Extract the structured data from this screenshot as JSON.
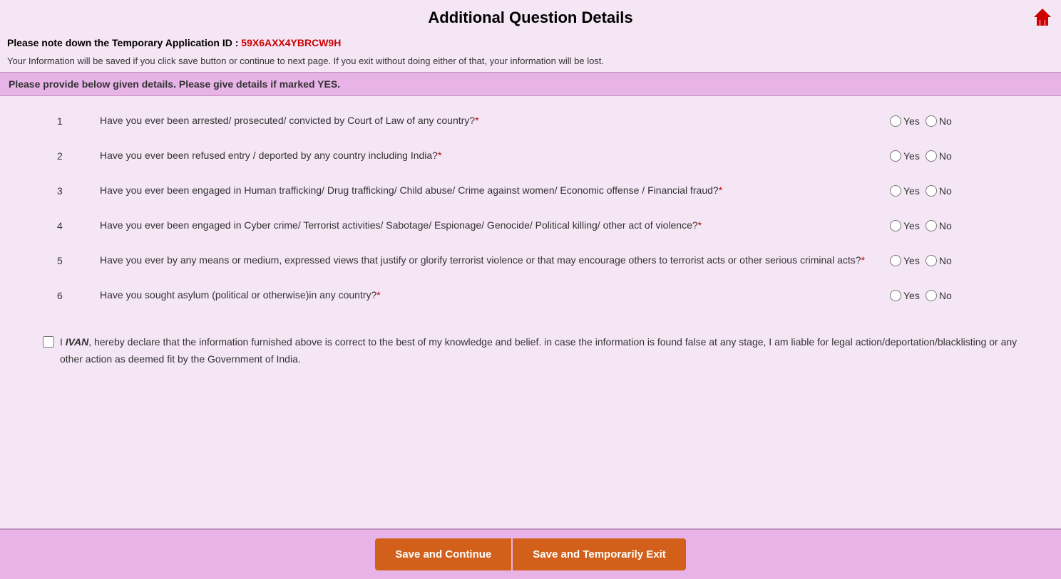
{
  "header": {
    "title": "Additional Question Details",
    "home_icon": "home"
  },
  "temp_id": {
    "label": "Please note down the Temporary Application ID :",
    "value": "59X6AXX4YBRCW9H"
  },
  "info_text": "Your Information will be saved if you click save button or continue to next page. If you exit without doing either of that, your information will be lost.",
  "notice": "Please provide below given details. Please give details if marked YES.",
  "questions": [
    {
      "number": "1",
      "text": "Have you ever been arrested/ prosecuted/ convicted by Court of Law of any country?",
      "required": true
    },
    {
      "number": "2",
      "text": "Have you ever been refused entry / deported by any country including India?",
      "required": true
    },
    {
      "number": "3",
      "text": "Have you ever been engaged in Human trafficking/ Drug trafficking/ Child abuse/ Crime against women/ Economic offense / Financial fraud?",
      "required": true
    },
    {
      "number": "4",
      "text": "Have you ever been engaged in Cyber crime/ Terrorist activities/ Sabotage/ Espionage/ Genocide/ Political killing/ other act of violence?",
      "required": true
    },
    {
      "number": "5",
      "text": "Have you ever by any means or medium, expressed views that justify or glorify terrorist violence or that may encourage others to terrorist acts or other serious criminal acts?",
      "required": true
    },
    {
      "number": "6",
      "text": "Have you sought asylum (political or otherwise)in any country?",
      "required": true
    }
  ],
  "yes_label": "Yes",
  "no_label": "No",
  "declaration": {
    "name": "IVAN",
    "text_before_name": "I ",
    "text_after_name": ", hereby declare that the information furnished above is correct to the best of my knowledge and belief. in case the information is found false at any stage, I am liable for legal action/deportation/blacklisting or any other action as deemed fit by the Government of India."
  },
  "buttons": {
    "save_continue": "Save and Continue",
    "save_exit": "Save and Temporarily Exit"
  }
}
